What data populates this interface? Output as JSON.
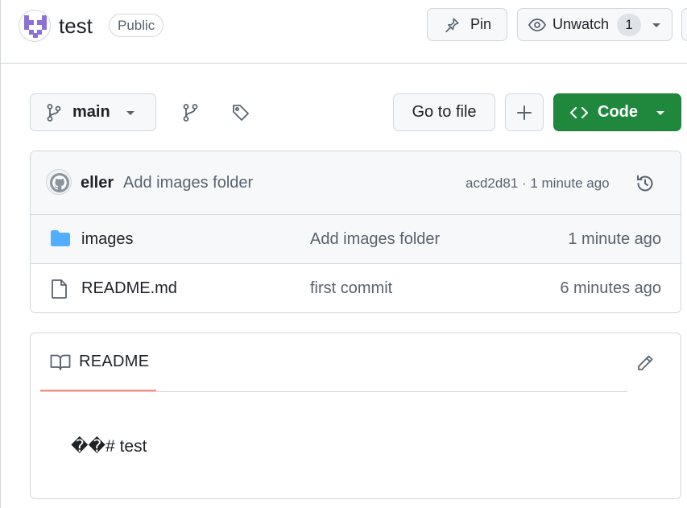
{
  "repo": {
    "name": "test",
    "visibility": "Public"
  },
  "header_actions": {
    "pin_label": "Pin",
    "watch_label": "Unwatch",
    "watch_count": "1"
  },
  "toolbar": {
    "branch_name": "main",
    "go_to_file_label": "Go to file",
    "code_label": "Code"
  },
  "latest_commit": {
    "author": "eller",
    "message": "Add images folder",
    "meta": "acd2d81 · 1 minute ago"
  },
  "files": [
    {
      "name": "images",
      "type": "folder",
      "commit_message": "Add images folder",
      "updated": "1 minute ago"
    },
    {
      "name": "README.md",
      "type": "file",
      "commit_message": "first commit",
      "updated": "6 minutes ago"
    }
  ],
  "readme": {
    "tab_label": "README",
    "content": "��# test"
  },
  "colors": {
    "primary_button": "#1f883d",
    "folder_icon": "#54aeff",
    "readme_tab_underline": "#fd8c73",
    "avatar_pixel": "#8c6fd8",
    "border": "#d0d7de"
  },
  "icons": [
    "pin-icon",
    "eye-icon",
    "chevron-down-icon",
    "branch-icon",
    "branches-icon",
    "tag-icon",
    "plus-icon",
    "code-icon",
    "history-icon",
    "folder-icon",
    "file-icon",
    "book-icon",
    "pencil-icon"
  ]
}
